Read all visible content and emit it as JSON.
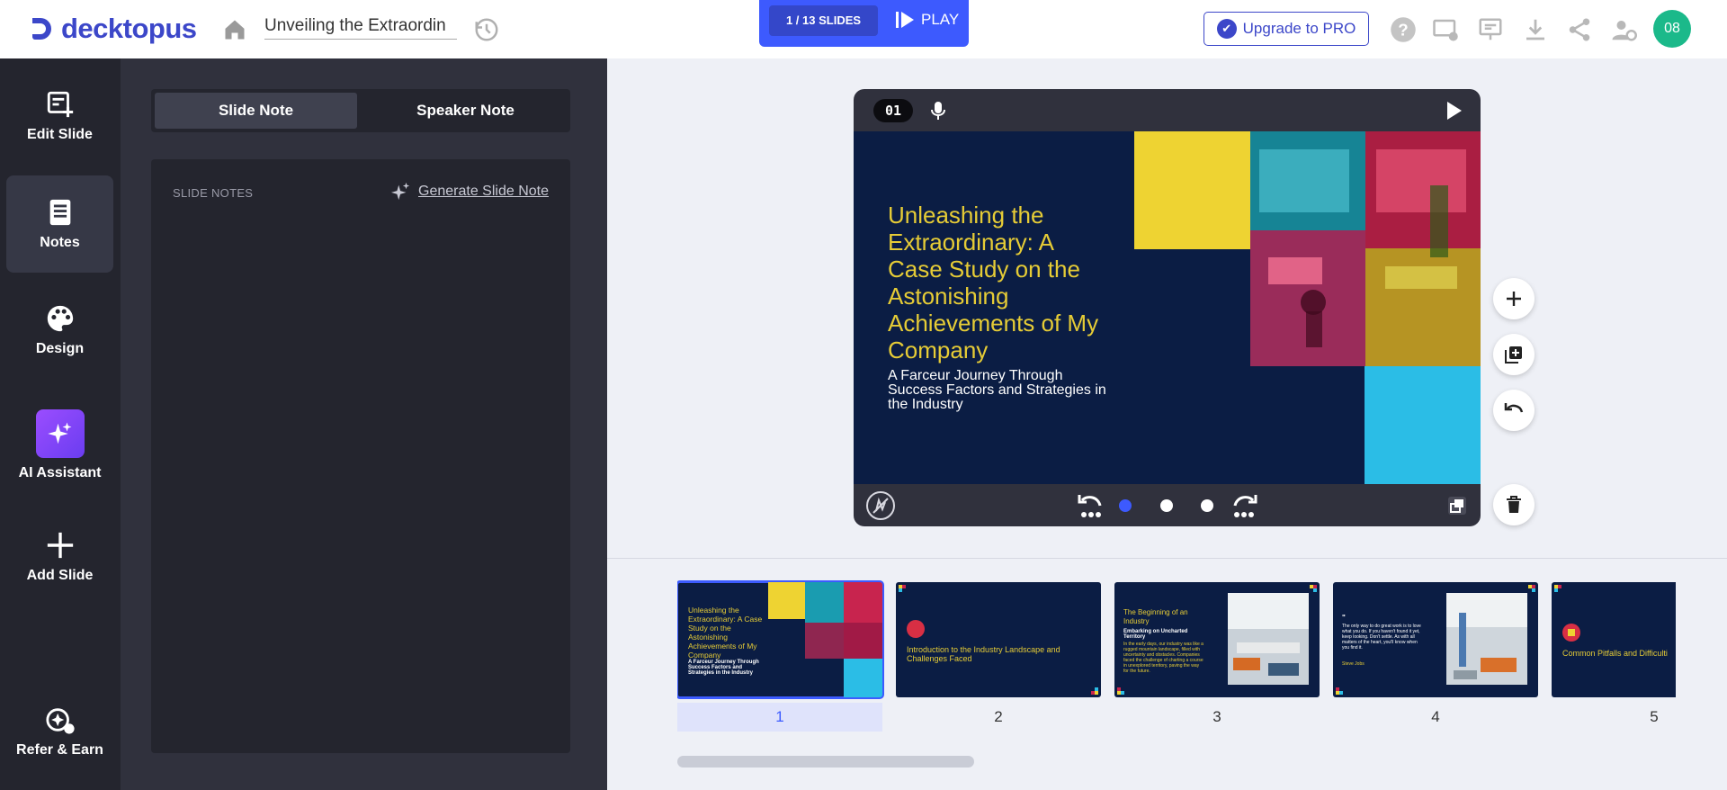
{
  "app": {
    "logo_text": "decktopus",
    "document_title": "Unveiling the Extraordin",
    "slides_counter": "1 / 13 SLIDES",
    "play_label": "PLAY",
    "upgrade_label": "Upgrade to PRO",
    "avatar_initials": "08",
    "brand_color": "#3c47c9"
  },
  "sidebar": {
    "items": [
      {
        "label": "Edit Slide",
        "icon": "edit-slide-icon"
      },
      {
        "label": "Notes",
        "icon": "notes-icon",
        "active": true
      },
      {
        "label": "Design",
        "icon": "palette-icon"
      },
      {
        "label": "AI Assistant",
        "icon": "sparkles-icon"
      },
      {
        "label": "Add Slide",
        "icon": "plus-icon"
      },
      {
        "label": "Refer & Earn",
        "icon": "refer-icon"
      }
    ]
  },
  "notes_panel": {
    "tabs": [
      {
        "label": "Slide Note",
        "selected": true
      },
      {
        "label": "Speaker Note",
        "selected": false
      }
    ],
    "section_label": "SLIDE NOTES",
    "generate_label": "Generate Slide Note"
  },
  "editor": {
    "slide_number": "01",
    "slide": {
      "title": "Unleashing the Extraordinary: A Case Study on the Astonishing Achievements of My Company",
      "subtitle": "A Farceur Journey Through Success Factors and Strategies in the Industry",
      "colors": {
        "background": "#0b1d44",
        "title": "#e6cc36",
        "yellow": "#eed332",
        "cyan": "#2bbde6"
      }
    },
    "animation_steps": {
      "total": 3,
      "current": 1
    }
  },
  "filmstrip": {
    "slides": [
      {
        "number": "1",
        "title": "Unleashing the Extraordinary: A Case Study on the Astonishing Achievements of My Company",
        "subtitle": "A Farceur Journey Through Success Factors and Strategies in the Industry"
      },
      {
        "number": "2",
        "title": "Introduction to the Industry Landscape and Challenges Faced"
      },
      {
        "number": "3",
        "title": "The Beginning of an Industry",
        "subtitle": "Embarking on Uncharted Territory",
        "body": "In the early days, our industry was like a rugged mountain landscape, filled with uncertainty and obstacles. Companies faced the challenge of charting a course in unexplored territory, paving the way for the future."
      },
      {
        "number": "4",
        "title": "\"",
        "body": "The only way to do great work is to love what you do. If you haven't found it yet, keep looking. Don't settle. As with all matters of the heart, you'll know when you find it.",
        "author": "Steve Jobs"
      },
      {
        "number": "5",
        "title": "Common Pitfalls and Difficulti"
      }
    ]
  }
}
